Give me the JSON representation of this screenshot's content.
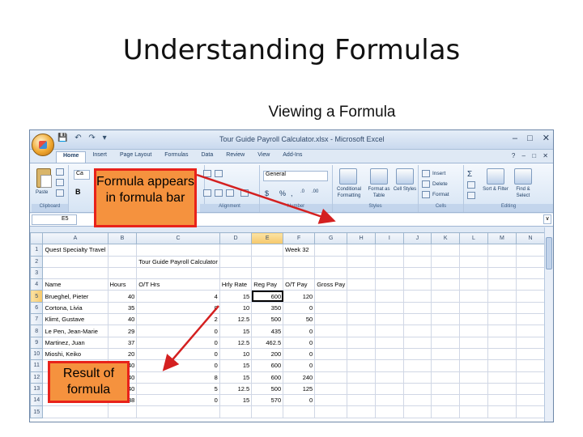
{
  "slide": {
    "title": "Understanding Formulas",
    "subtitle": "Viewing a Formula"
  },
  "excel": {
    "window_title": "Tour Guide Payroll Calculator.xlsx - Microsoft Excel",
    "tabs": [
      "Home",
      "Insert",
      "Page Layout",
      "Formulas",
      "Data",
      "Review",
      "View",
      "Add-Ins"
    ],
    "active_tab": "Home",
    "ribbon": {
      "clipboard_label": "Clipboard",
      "paste_label": "Paste",
      "alignment_label": "Alignment",
      "number_label": "Number",
      "number_format": "General",
      "number_symbols": [
        "$",
        "%",
        ",",
        ".0",
        ".00"
      ],
      "styles_label": "Styles",
      "conditional_formatting": "Conditional Formatting",
      "format_as_table": "Format as Table",
      "cell_styles": "Cell Styles",
      "cells_label": "Cells",
      "insert": "Insert",
      "delete": "Delete",
      "format": "Format",
      "editing_label": "Editing",
      "sort_filter": "Sort & Filter",
      "find_select": "Find & Select"
    },
    "name_box": "E5",
    "columns": [
      "A",
      "B",
      "C",
      "D",
      "E",
      "F",
      "G",
      "H",
      "I",
      "J",
      "K",
      "L",
      "M",
      "N"
    ],
    "active_cell": "E5",
    "rows": [
      [
        "Quest Specialty Travel",
        "",
        "",
        "",
        "",
        "Week 32",
        "",
        "",
        "",
        "",
        "",
        "",
        "",
        ""
      ],
      [
        "",
        "",
        "Tour Guide Payroll Calculator",
        "",
        "",
        "",
        "",
        "",
        "",
        "",
        "",
        "",
        "",
        ""
      ],
      [
        "",
        "",
        "",
        "",
        "",
        "",
        "",
        "",
        "",
        "",
        "",
        "",
        "",
        ""
      ],
      [
        "Name",
        "Hours",
        "O/T Hrs",
        "Hrly Rate",
        "Reg Pay",
        "O/T Pay",
        "Gross Pay",
        "",
        "",
        "",
        "",
        "",
        "",
        ""
      ],
      [
        "Brueghel, Pieter",
        "40",
        "4",
        "15",
        "600",
        "120",
        "",
        "",
        "",
        "",
        "",
        "",
        "",
        ""
      ],
      [
        "Cortona, Livia",
        "35",
        "0",
        "10",
        "350",
        "0",
        "",
        "",
        "",
        "",
        "",
        "",
        "",
        ""
      ],
      [
        "Klimt, Gustave",
        "40",
        "2",
        "12.5",
        "500",
        "50",
        "",
        "",
        "",
        "",
        "",
        "",
        "",
        ""
      ],
      [
        "Le Pen, Jean-Marie",
        "29",
        "0",
        "15",
        "435",
        "0",
        "",
        "",
        "",
        "",
        "",
        "",
        "",
        ""
      ],
      [
        "Martinez, Juan",
        "37",
        "0",
        "12.5",
        "462.5",
        "0",
        "",
        "",
        "",
        "",
        "",
        "",
        "",
        ""
      ],
      [
        "Mioshi, Keiko",
        "20",
        "0",
        "10",
        "200",
        "0",
        "",
        "",
        "",
        "",
        "",
        "",
        "",
        ""
      ],
      [
        "",
        "40",
        "0",
        "15",
        "600",
        "0",
        "",
        "",
        "",
        "",
        "",
        "",
        "",
        ""
      ],
      [
        "",
        "40",
        "8",
        "15",
        "600",
        "240",
        "",
        "",
        "",
        "",
        "",
        "",
        "",
        ""
      ],
      [
        "",
        "40",
        "5",
        "12.5",
        "500",
        "125",
        "",
        "",
        "",
        "",
        "",
        "",
        "",
        ""
      ],
      [
        "",
        "38",
        "0",
        "15",
        "570",
        "0",
        "",
        "",
        "",
        "",
        "",
        "",
        "",
        ""
      ],
      [
        "",
        "",
        "",
        "",
        "",
        "",
        "",
        "",
        "",
        "",
        "",
        "",
        "",
        ""
      ]
    ]
  },
  "callouts": {
    "formula": "Formula appears in formula bar",
    "result": "Result of formula"
  },
  "colors": {
    "callout_fill": "#f5923e",
    "callout_border": "#e8221a",
    "arrow": "#d42020"
  }
}
